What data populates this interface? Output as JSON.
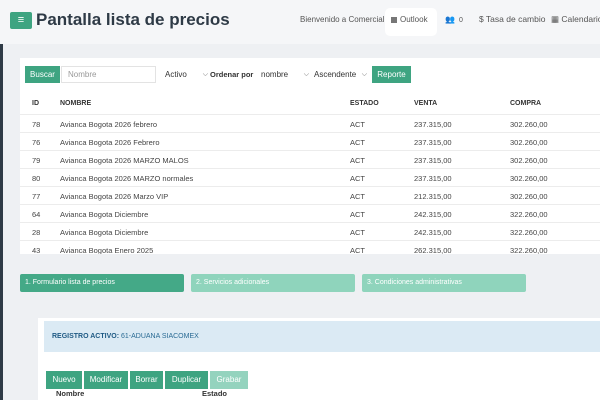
{
  "header": {
    "title": "Pantalla lista de precios",
    "welcome": "Bienvenido a Comercial.",
    "outlook": "Outlook",
    "users_count": "0",
    "tasa": "$ Tasa de cambio",
    "calendario": "Calendario"
  },
  "search": {
    "buscar": "Buscar",
    "placeholder": "Nombre",
    "estado": "Activo",
    "ordenar_label": "Ordenar por",
    "orden_campo": "nombre",
    "orden_dir": "Ascendente",
    "reporte": "Reporte"
  },
  "table": {
    "headers": [
      "ID",
      "NOMBRE",
      "ESTADO",
      "VENTA",
      "COMPRA"
    ],
    "rows": [
      [
        "78",
        "Avianca Bogota 2026 febrero",
        "ACT",
        "237.315,00",
        "302.260,00"
      ],
      [
        "76",
        "Avianca Bogota 2026 Febrero",
        "ACT",
        "237.315,00",
        "302.260,00"
      ],
      [
        "79",
        "Avianca Bogota 2026 MARZO MALOS",
        "ACT",
        "237.315,00",
        "302.260,00"
      ],
      [
        "80",
        "Avianca Bogota 2026 MARZO normales",
        "ACT",
        "237.315,00",
        "302.260,00"
      ],
      [
        "77",
        "Avianca Bogota 2026 Marzo VIP",
        "ACT",
        "212.315,00",
        "302.260,00"
      ],
      [
        "64",
        "Avianca Bogota Diciembre",
        "ACT",
        "242.315,00",
        "322.260,00"
      ],
      [
        "28",
        "Avianca Bogota Diciembre",
        "ACT",
        "242.315,00",
        "322.260,00"
      ],
      [
        "43",
        "Avianca Bogota Enero 2025",
        "ACT",
        "262.315,00",
        "322.260,00"
      ]
    ]
  },
  "tabs": [
    "1. Formulario lista de precios",
    "2. Servicios adicionales",
    "3. Condiciones administrativas"
  ],
  "registro": {
    "label": "REGISTRO ACTIVO:",
    "value": "61-ADUANA SIACOMEX"
  },
  "actions": {
    "nuevo": "Nuevo",
    "modificar": "Modificar",
    "borrar": "Borrar",
    "duplicar": "Duplicar",
    "grabar": "Grabar"
  },
  "form_labels": {
    "nombre": "Nombre",
    "estado": "Estado"
  }
}
